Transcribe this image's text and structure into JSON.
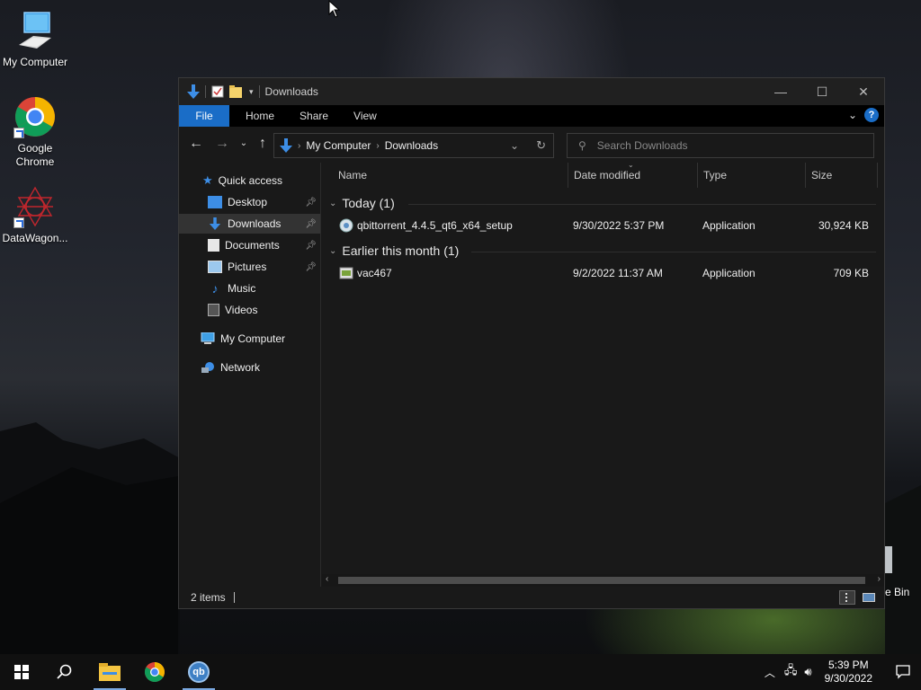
{
  "desktop": {
    "icons": [
      {
        "label": "My Computer"
      },
      {
        "label": "Google Chrome"
      },
      {
        "label": "DataWagon..."
      }
    ],
    "recycle_label": "e Bin"
  },
  "window": {
    "title": "Downloads",
    "ribbon_tabs": [
      "File",
      "Home",
      "Share",
      "View"
    ],
    "address": [
      "My Computer",
      "Downloads"
    ],
    "search_placeholder": "Search Downloads",
    "nav": {
      "quick_access": "Quick access",
      "items": [
        {
          "label": "Desktop",
          "pinned": true
        },
        {
          "label": "Downloads",
          "pinned": true,
          "selected": true
        },
        {
          "label": "Documents",
          "pinned": true
        },
        {
          "label": "Pictures",
          "pinned": true
        },
        {
          "label": "Music",
          "pinned": false
        },
        {
          "label": "Videos",
          "pinned": false
        }
      ],
      "my_computer": "My Computer",
      "network": "Network"
    },
    "columns": [
      "Name",
      "Date modified",
      "Type",
      "Size"
    ],
    "groups": [
      {
        "label": "Today (1)",
        "files": [
          {
            "name": "qbittorrent_4.4.5_qt6_x64_setup",
            "date": "9/30/2022 5:37 PM",
            "type": "Application",
            "size": "30,924 KB"
          }
        ]
      },
      {
        "label": "Earlier this month (1)",
        "files": [
          {
            "name": "vac467",
            "date": "9/2/2022 11:37 AM",
            "type": "Application",
            "size": "709 KB"
          }
        ]
      }
    ],
    "status": "2 items"
  },
  "taskbar": {
    "time": "5:39 PM",
    "date": "9/30/2022"
  },
  "colors": {
    "accent": "#1a6dc7",
    "window_bg": "#191919",
    "taskbar_bg": "#101010"
  }
}
